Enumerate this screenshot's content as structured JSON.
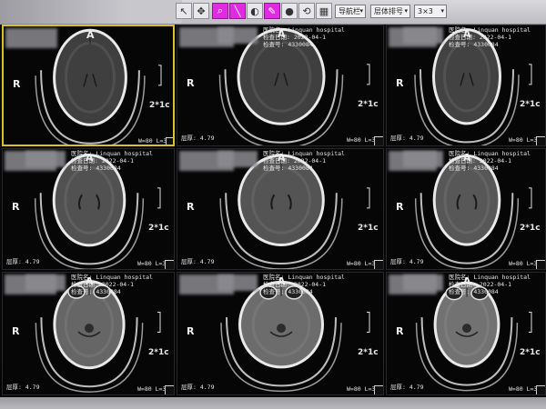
{
  "toolbar": {
    "drop1": "导航栏",
    "drop2": "层体排号",
    "drop3": "3×3"
  },
  "overlay": {
    "orient_top": "A",
    "orient_side": "R",
    "thickness": "2*1c",
    "hospital_label": "医院名: Linquan hospital",
    "date_label": "检查日期: 2022-04-1",
    "id_label": "检查号: 4330084",
    "thick_label": "层厚: 4.79",
    "window": "W=80 L=35"
  },
  "tiles": [
    {
      "level": 0.05,
      "hospital": false
    },
    {
      "level": 0.05,
      "hospital": true
    },
    {
      "level": 0.1,
      "hospital": true
    },
    {
      "level": 0.35,
      "hospital": true
    },
    {
      "level": 0.4,
      "hospital": true
    },
    {
      "level": 0.45,
      "hospital": true
    },
    {
      "level": 0.7,
      "hospital": true
    },
    {
      "level": 0.8,
      "hospital": true
    },
    {
      "level": 0.9,
      "hospital": true
    }
  ]
}
